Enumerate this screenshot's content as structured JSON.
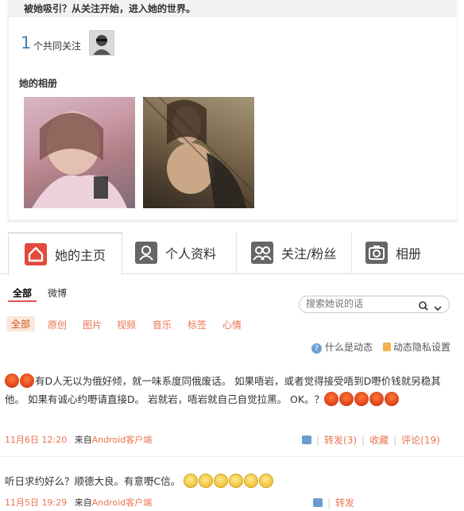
{
  "top_message": "被她吸引？从关注开始，进入她的世界。",
  "mutual": {
    "count": "1",
    "label": "个共同关注"
  },
  "album": {
    "title": "她的相册"
  },
  "tabs": [
    {
      "label": "她的主页",
      "icon": "home-icon"
    },
    {
      "label": "个人资料",
      "icon": "profile-icon"
    },
    {
      "label": "关注/粉丝",
      "icon": "follow-icon"
    },
    {
      "label": "相册",
      "icon": "camera-icon"
    }
  ],
  "filter_tabs": [
    "全部",
    "微博"
  ],
  "search": {
    "placeholder": "搜索她说的话"
  },
  "categories": [
    "全部",
    "原创",
    "图片",
    "视频",
    "音乐",
    "标签",
    "心情"
  ],
  "help": {
    "what_is": "什么是动态",
    "privacy": "动态隐私设置"
  },
  "posts": [
    {
      "text": "有D人无以为俄好倾，就一味系度同俄废话。 如果唔岩，或者觉得接受唔到D嘢价钱就另稳其他。 如果有诚心约嘢请直接D。 岩就岩，唔岩就自己自觉拉黑。 OK。？",
      "time": "11月6日 12:20",
      "source_prefix": "来自",
      "source": "Android客户端",
      "repost": "转发(3)",
      "fav": "收藏",
      "comment": "评论(19)"
    },
    {
      "text": "听日求约好么？顺德大良。有意嘢C信。",
      "time": "11月5日 19:29",
      "source_prefix": "来自",
      "source": "Android客户端",
      "repost": "转发"
    }
  ],
  "colors": {
    "accent": "#eb7350",
    "active_tab_icon": "#e24a3e",
    "tab_icon": "#666666",
    "link_blue": "#3a7fc1"
  }
}
